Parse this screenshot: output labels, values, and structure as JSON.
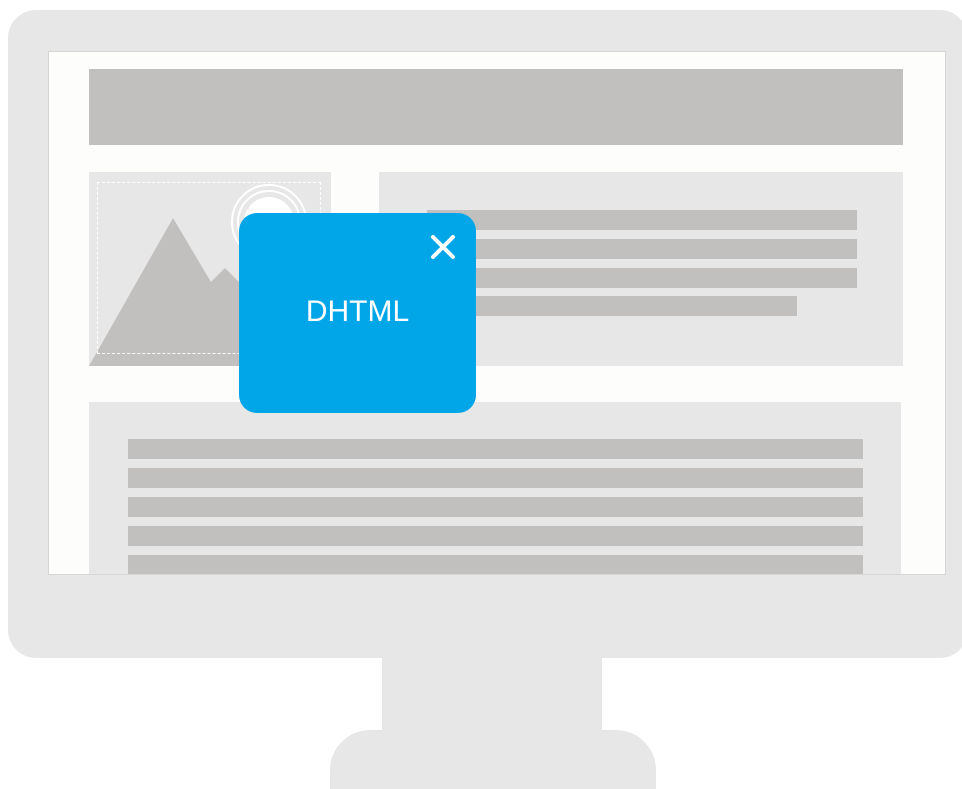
{
  "popup": {
    "title": "DHTML",
    "close_icon": "close-icon",
    "color": "#00a6e8"
  },
  "colors": {
    "bezel": "#e8e7e7",
    "screen": "#fdfdfc",
    "placeholder_bar": "#c1c0be",
    "panel": "#e8e7e7"
  },
  "icons": {
    "image": "image-placeholder-icon"
  }
}
